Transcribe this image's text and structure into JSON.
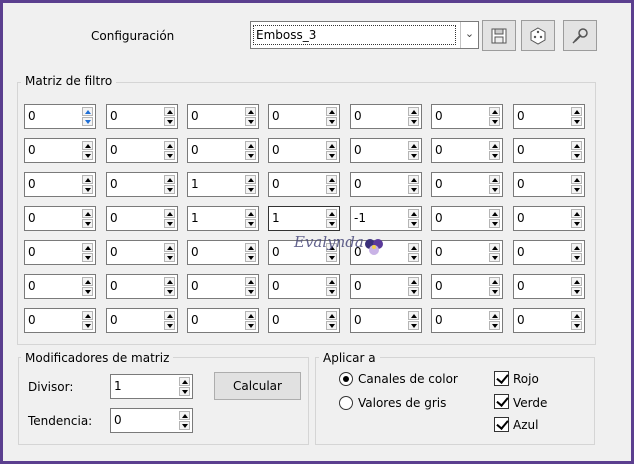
{
  "header": {
    "config_label": "Configuración",
    "preset_value": "Emboss_3",
    "buttons": [
      "save-icon",
      "randomize-icon",
      "reset-icon"
    ]
  },
  "matrix": {
    "title": "Matriz de filtro",
    "rows": [
      [
        "0",
        "0",
        "0",
        "0",
        "0",
        "0",
        "0"
      ],
      [
        "0",
        "0",
        "0",
        "0",
        "0",
        "0",
        "0"
      ],
      [
        "0",
        "0",
        "1",
        "0",
        "0",
        "0",
        "0"
      ],
      [
        "0",
        "0",
        "1",
        "1",
        "-1",
        "0",
        "0"
      ],
      [
        "0",
        "0",
        "0",
        "0",
        "0",
        "0",
        "0"
      ],
      [
        "0",
        "0",
        "0",
        "0",
        "0",
        "0",
        "0"
      ],
      [
        "0",
        "0",
        "0",
        "0",
        "0",
        "0",
        "0"
      ]
    ]
  },
  "modifiers": {
    "title": "Modificadores de matriz",
    "divisor_label": "Divisor:",
    "divisor_value": "1",
    "bias_label": "Tendencia:",
    "bias_value": "0",
    "calc_label": "Calcular"
  },
  "apply": {
    "title": "Aplicar a",
    "radio_color": "Canales de color",
    "radio_gray": "Valores de gris",
    "check_red": "Rojo",
    "check_green": "Verde",
    "check_blue": "Azul"
  },
  "watermark": "Evalynda"
}
